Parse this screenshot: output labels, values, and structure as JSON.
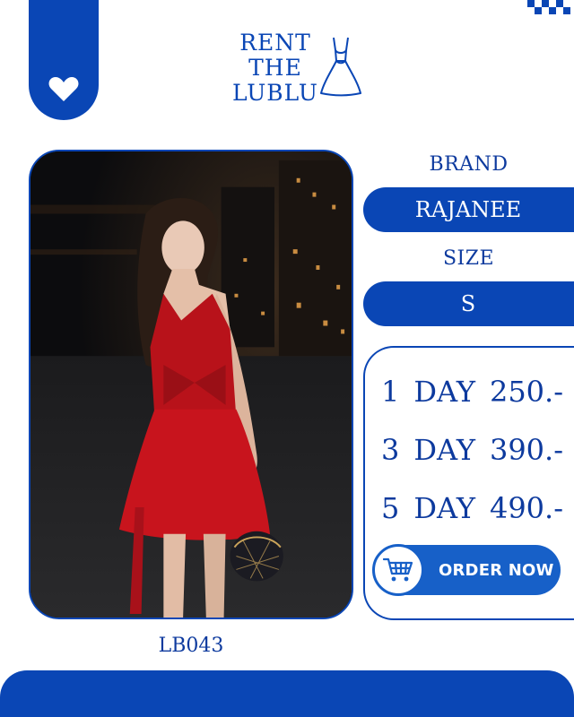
{
  "brand_logo": {
    "line1": "RENT",
    "line2": "THE",
    "line3": "LUBLU",
    "icon": "dress-icon"
  },
  "favorite": {
    "icon": "heart-icon"
  },
  "product": {
    "code": "LB043",
    "photo_alt": "woman-in-red-dress-photo",
    "brand_label": "BRAND",
    "brand_value": "RAJANEE",
    "size_label": "SIZE",
    "size_value": "S"
  },
  "pricing": [
    {
      "days": "1",
      "unit": "DAY",
      "price": "250.-"
    },
    {
      "days": "3",
      "unit": "DAY",
      "price": "390.-"
    },
    {
      "days": "5",
      "unit": "DAY",
      "price": "490.-"
    }
  ],
  "order_button": {
    "label": "ORDER NOW",
    "icon": "cart-icon"
  },
  "colors": {
    "primary": "#0a46b5",
    "button": "#1760c8",
    "text": "#0d3a9e",
    "background": "#ffffff"
  }
}
